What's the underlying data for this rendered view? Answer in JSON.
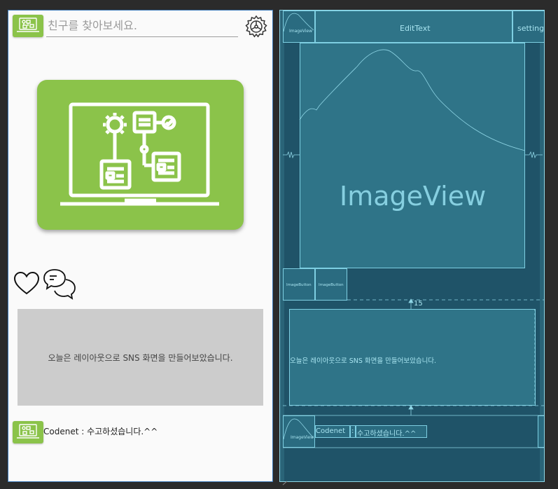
{
  "design_view": {
    "search": {
      "placeholder": "친구를 찾아보세요."
    },
    "icons": {
      "logo": "laptop-flow-icon",
      "settings": "gear-icon",
      "like": "heart-icon",
      "comment": "chat-bubbles-icon"
    },
    "post_text": "오늘은 레이아웃으로 SNS 화면을 만들어보았습니다.",
    "comment_text": "Codenet : 수고하셨습니다.^^"
  },
  "blueprint_view": {
    "top_image_label": "ImageView",
    "edittext_label": "EditText",
    "setting_label": "setting",
    "hero_label": "ImageView",
    "image_button_1": "ImageButton",
    "image_button_2": "ImageButton",
    "margin_label": "15",
    "post_text": "오늘은 레이아웃으로 SNS 화면을 만들어보았습니다.",
    "comment_image_label": "ImageView",
    "comment_user": "Codenet",
    "comment_sep": ":",
    "comment_text": "수고하셨습니다.^^"
  },
  "colors": {
    "brand_green": "#8bc34a",
    "blueprint_bg": "#1f5368",
    "blueprint_line": "#7ecfe2",
    "canvas_bg": "#2b2b2b"
  }
}
